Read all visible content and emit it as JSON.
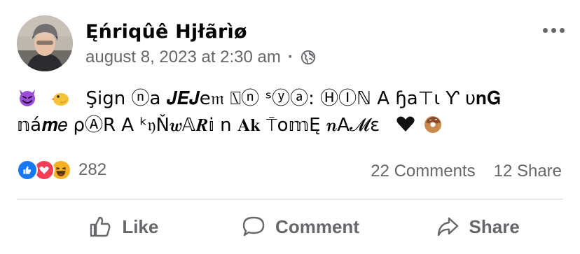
{
  "post": {
    "author": "Ęńriqûê Hjłãrìø",
    "timestamp": "august 8, 2023 at 2:30 am",
    "separator": "·",
    "privacy_icon": "globe-icon",
    "more_icon": "more-options-icon",
    "text_line_1": "Şign ⓝa 𝑱𝑬𝑱e𝔪 ⍂ⓝ ˢⓨⓐ: ⒽⒾℕ A ɧa⊤ɩ Ƴ υ𝐧𝐆",
    "text_line_2": "𝕟á𝒎𝑒 ρⒶR A ᵏ𝔶Ň𝒘𝔸𝑹𝕚 n 𝐀𝐤 ⍑o𝕞Ę 𝒏A𝓜ɛ",
    "emoji_1": "smiling-devil-emoji",
    "emoji_2": "baby-chick-emoji",
    "emoji_3": "black-heart-emoji",
    "emoji_4": "doughnut-emoji"
  },
  "stats": {
    "reaction_count": "282",
    "comments": "22 Comments",
    "shares": "12 Share",
    "reactions": [
      "like-reaction-icon",
      "love-reaction-icon",
      "haha-reaction-icon"
    ]
  },
  "actions": {
    "like": "Like",
    "comment": "Comment",
    "share": "Share"
  },
  "colors": {
    "secondary_text": "#65676b",
    "like_blue": "#1877f2",
    "love_red": "#f33e58",
    "haha_yellow": "#f7b125",
    "divider": "#ced0d4"
  }
}
